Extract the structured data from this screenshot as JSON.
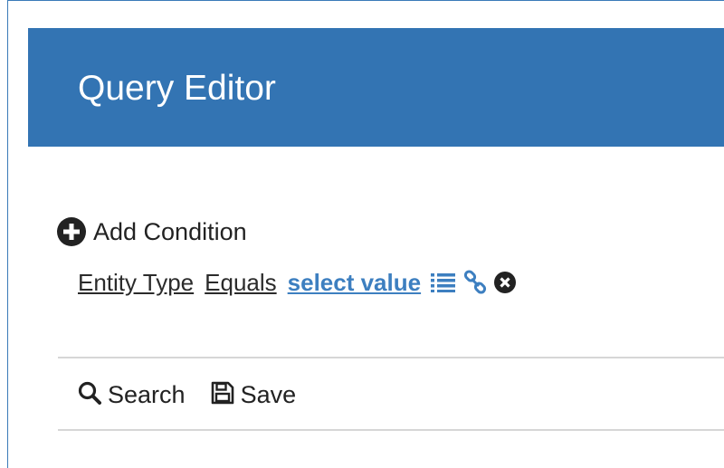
{
  "header": {
    "title": "Query Editor"
  },
  "add_condition": {
    "label": "Add Condition",
    "icon": "plus-circle-icon"
  },
  "condition": {
    "field": "Entity Type",
    "operator": "Equals",
    "value_placeholder": "select value",
    "icons": [
      "list-icon",
      "link-icon",
      "remove-circle-icon"
    ]
  },
  "toolbar": {
    "search_label": "Search",
    "save_label": "Save"
  },
  "colors": {
    "header_bg": "#3374b3",
    "link_blue": "#3d7fc0",
    "text": "#222222",
    "divider": "#d6d6d6"
  }
}
